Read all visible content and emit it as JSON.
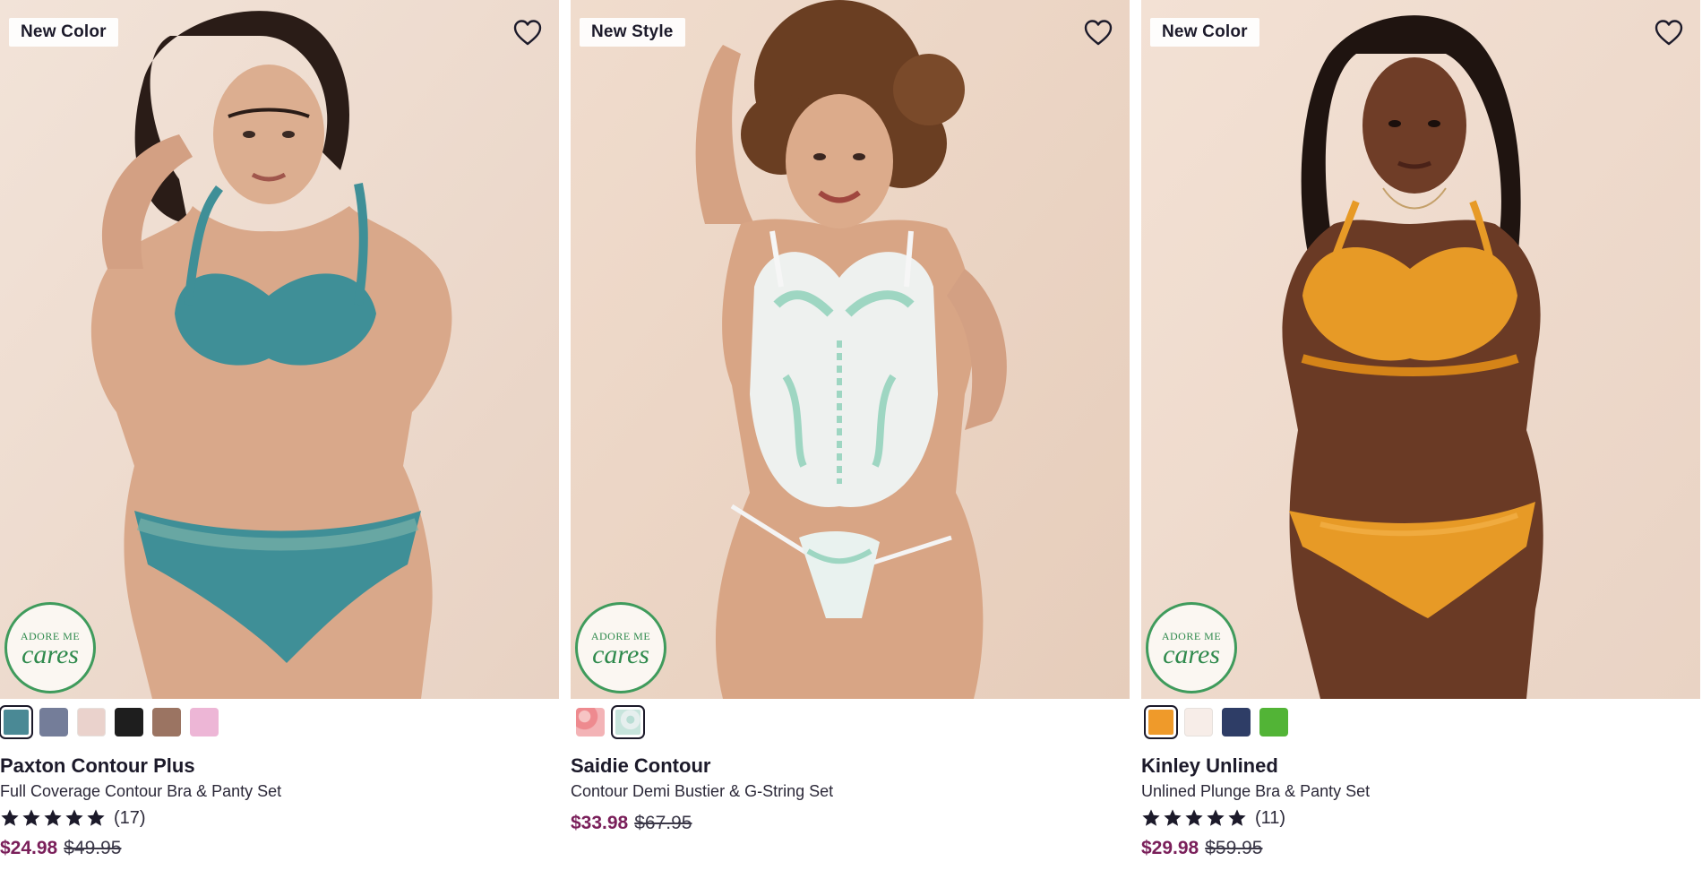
{
  "products": [
    {
      "badge": "New Color",
      "cares_top": "ADORE ME",
      "cares_bottom": "cares",
      "swatch_colors": [
        "#4a8995",
        "#747d99",
        "#ead2cc",
        "#1e1e1e",
        "#9b7462",
        "#edb6d6"
      ],
      "selected_swatch": 0,
      "name": "Paxton Contour Plus",
      "description": "Full Coverage Contour Bra & Panty Set",
      "rating_stars": 5,
      "rating_count": "(17)",
      "sale_price": "$24.98",
      "original_price": "$49.95",
      "garment_color": "#3f8f97",
      "skin_color": "#d9a88a",
      "hair_color": "#2a1c17"
    },
    {
      "badge": "New Style",
      "cares_top": "ADORE ME",
      "cares_bottom": "cares",
      "swatch_colors": [
        "#ee8a8f",
        "#e6efee"
      ],
      "selected_swatch": 1,
      "name": "Saidie Contour",
      "description": "Contour Demi Bustier & G-String Set",
      "rating_stars": 0,
      "rating_count": "",
      "sale_price": "$33.98",
      "original_price": "$67.95",
      "garment_color": "#eef1ef",
      "skin_color": "#d8a585",
      "hair_color": "#6a3e22"
    },
    {
      "badge": "New Color",
      "cares_top": "ADORE ME",
      "cares_bottom": "cares",
      "swatch_colors": [
        "#ef9a2a",
        "#f7ede8",
        "#2e3d66",
        "#52b436"
      ],
      "selected_swatch": 0,
      "name": "Kinley Unlined",
      "description": "Unlined Plunge Bra & Panty Set",
      "rating_stars": 5,
      "rating_count": "(11)",
      "sale_price": "$29.98",
      "original_price": "$59.95",
      "garment_color": "#e79a26",
      "skin_color": "#6a3a25",
      "hair_color": "#1f1410"
    }
  ],
  "theme": {
    "background": "#efdccf",
    "sale_color": "#7a1f5a",
    "text_color": "#1c1a2a",
    "cares_green": "#3f9b5c"
  }
}
